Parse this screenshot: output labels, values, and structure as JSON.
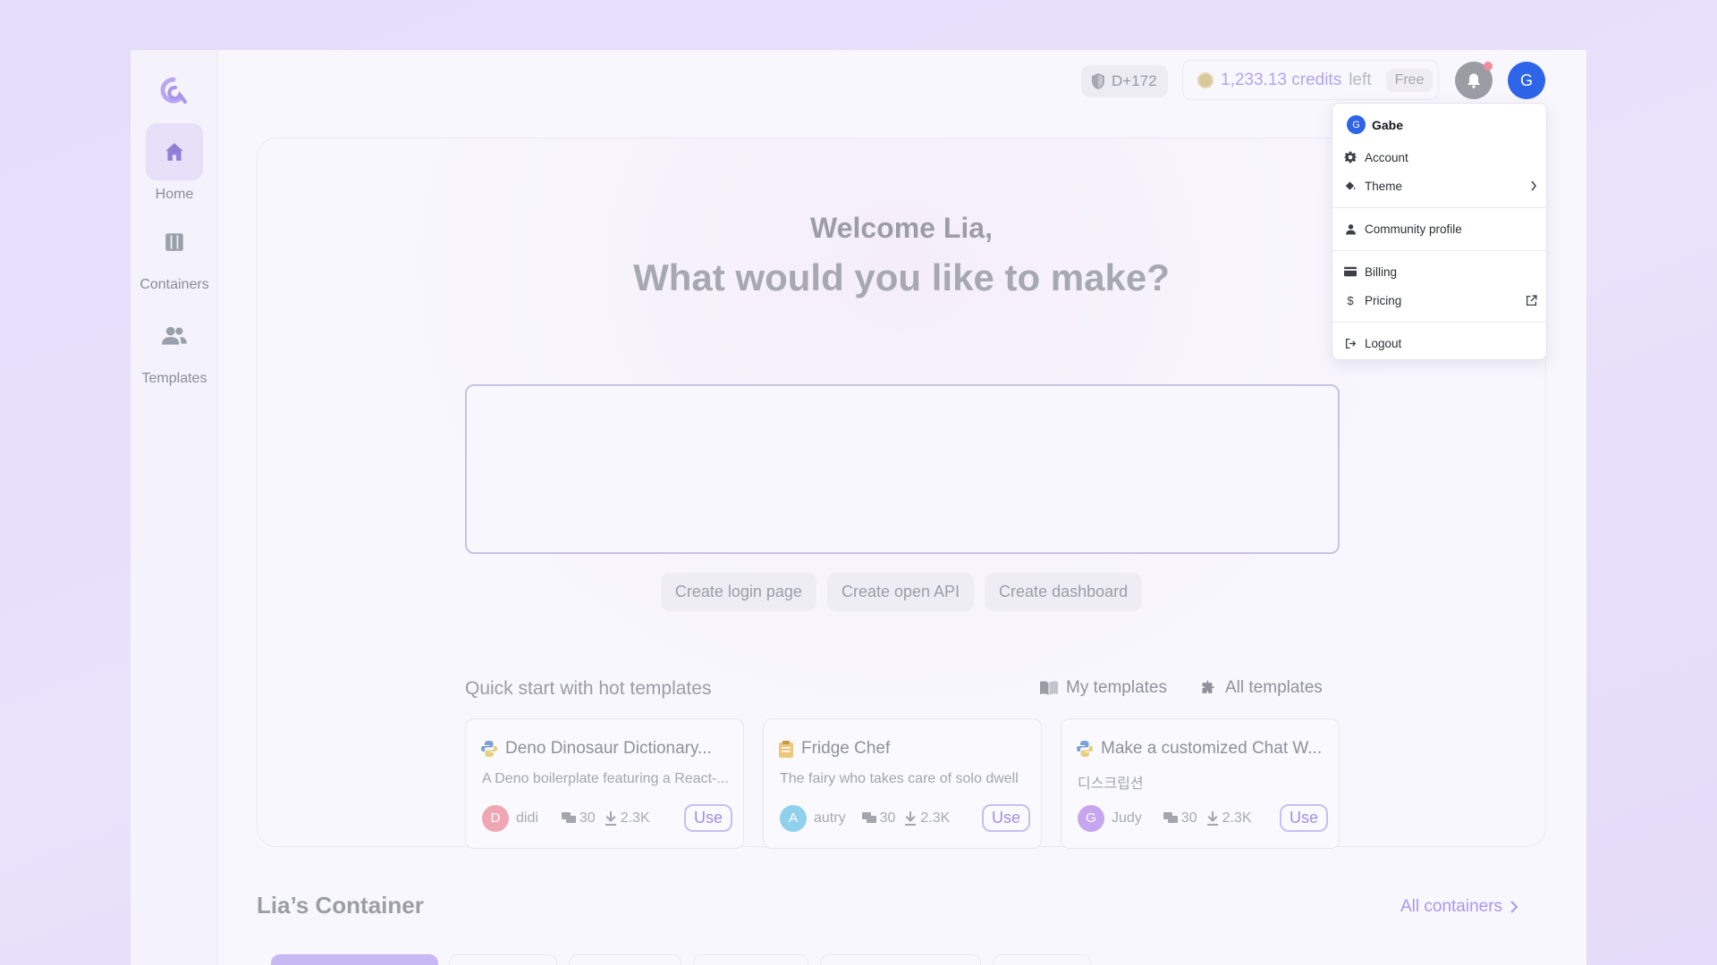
{
  "sidebar": {
    "items": [
      {
        "label": "Home",
        "icon": "home-icon",
        "active": true
      },
      {
        "label": "Containers",
        "icon": "containers-icon",
        "active": false
      },
      {
        "label": "Templates",
        "icon": "people-icon",
        "active": false
      }
    ]
  },
  "header": {
    "badge": "D+172",
    "credits_value": "1,233.13 credits",
    "credits_suffix": "left",
    "plan": "Free",
    "avatar_initial": "G"
  },
  "main": {
    "welcome": "Welcome Lia,",
    "question": "What would you like to make?",
    "prompt_placeholder": "",
    "suggestions": [
      "Create login page",
      "Create open API",
      "Create dashboard"
    ],
    "quick_start_title": "Quick start with hot templates",
    "my_templates": "My templates",
    "all_templates": "All templates",
    "templates": [
      {
        "title": "Deno Dinosaur Dictionary...",
        "desc": "A Deno boilerplate featuring a React-...",
        "icon": "python-icon",
        "author": "didi",
        "author_initial": "D",
        "author_color": "#f0a7b4",
        "comments": "30",
        "downloads": "2.3K",
        "use": "Use"
      },
      {
        "title": "Fridge Chef",
        "desc": "The fairy who takes care of solo dwell",
        "icon": "clipboard-icon",
        "author": "autry",
        "author_initial": "A",
        "author_color": "#8fd0ec",
        "comments": "30",
        "downloads": "2.3K",
        "use": "Use"
      },
      {
        "title": "Make a customized Chat W...",
        "desc": "디스크립션",
        "icon": "python-icon",
        "author": "Judy",
        "author_initial": "G",
        "author_color": "#c7a6f0",
        "comments": "30",
        "downloads": "2.3K",
        "use": "Use"
      }
    ]
  },
  "container_section": {
    "title": "Lia’s Container",
    "all_link": "All containers"
  },
  "user_menu": {
    "user_initial": "G",
    "user_name": "Gabe",
    "items": [
      {
        "label": "Account",
        "icon": "gear-icon"
      },
      {
        "label": "Theme",
        "icon": "paint-bucket-icon"
      },
      {
        "label": "Community profile",
        "icon": "person-icon"
      },
      {
        "label": "Billing",
        "icon": "credit-card-icon"
      },
      {
        "label": "Pricing",
        "icon": "dollar-icon"
      },
      {
        "label": "Logout",
        "icon": "logout-icon"
      }
    ]
  },
  "colors": {
    "accent": "#a998ee",
    "avatar_blue": "#2d64e8",
    "notification_dot": "#f08c9c"
  }
}
